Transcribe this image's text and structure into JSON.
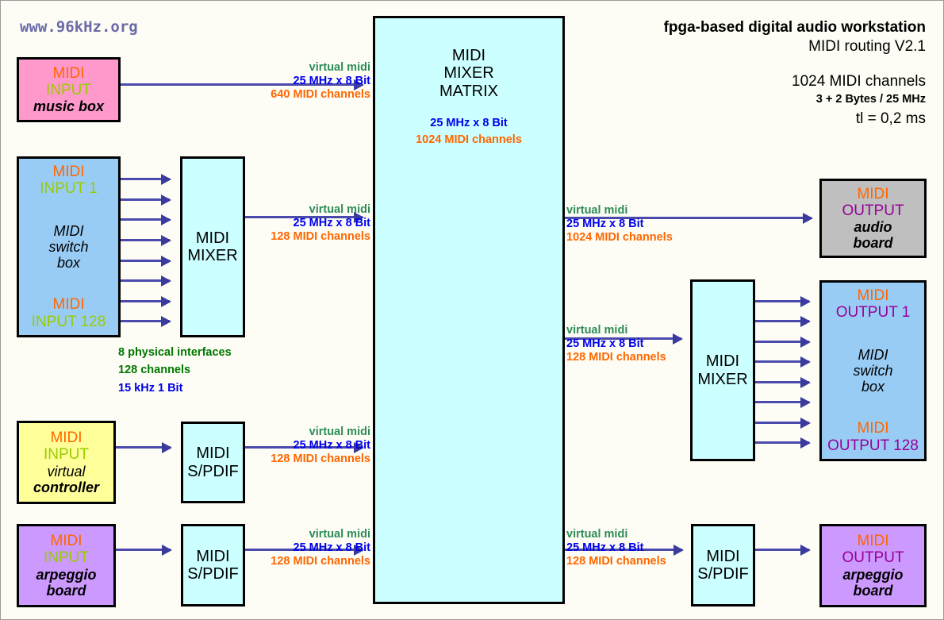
{
  "site_label": "www.96kHz.org",
  "header": {
    "title": "fpga-based digital audio workstation",
    "subtitle": "MIDI routing V2.1",
    "channels": "1024 MIDI channels",
    "bytes": "3 + 2 Bytes / 25 MHz",
    "latency": "tl = 0,2 ms"
  },
  "colors": {
    "pink": "#ff99cc",
    "blue": "#99ccf5",
    "yellow": "#ffff99",
    "purple": "#cc99ff",
    "grey": "#bfbfbf",
    "cyan": "#ccffff",
    "orange_text": "#ff6600",
    "green_text": "#99cc00",
    "purple_text": "#990099",
    "link_green": "#2e8b57",
    "link_blue": "#0000ee",
    "link_orange": "#ff6600",
    "arrow": "#4a4aad",
    "note_green": "#007700"
  },
  "boxes": {
    "input_music_box": {
      "midi": "MIDI",
      "io": "INPUT",
      "name1": "music box"
    },
    "input_switch_box": {
      "midi": "MIDI",
      "io": "INPUT 1",
      "name1": "MIDI",
      "name2": "switch",
      "name3": "box",
      "midi2": "MIDI",
      "io2": "INPUT 128"
    },
    "input_virtual": {
      "midi": "MIDI",
      "io": "INPUT",
      "name1": "virtual",
      "name2": "controller"
    },
    "input_arpeggio": {
      "midi": "MIDI",
      "io": "INPUT",
      "name1": "arpeggio",
      "name2": "board"
    },
    "mixer_left": {
      "line1": "MIDI",
      "line2": "MIXER"
    },
    "spdif_left_1": {
      "line1": "MIDI",
      "line2": "S/PDIF"
    },
    "spdif_left_2": {
      "line1": "MIDI",
      "line2": "S/PDIF"
    },
    "matrix": {
      "line1": "MIDI",
      "line2": "MIXER",
      "line3": "MATRIX",
      "rate": "25 MHz x 8 Bit",
      "channels": "1024 MIDI channels"
    },
    "mixer_right": {
      "line1": "MIDI",
      "line2": "MIXER"
    },
    "spdif_right": {
      "line1": "MIDI",
      "line2": "S/PDIF"
    },
    "output_audio": {
      "midi": "MIDI",
      "io": "OUTPUT",
      "name1": "audio",
      "name2": "board"
    },
    "output_switch_box": {
      "midi": "MIDI",
      "io": "OUTPUT 1",
      "name1": "MIDI",
      "name2": "switch",
      "name3": "box",
      "midi2": "MIDI",
      "io2": "OUTPUT 128"
    },
    "output_arpeggio": {
      "midi": "MIDI",
      "io": "OUTPUT",
      "name1": "arpeggio",
      "name2": "board"
    }
  },
  "links": {
    "music_to_matrix": {
      "l1": "virtual midi",
      "l2": "25 MHz x 8 Bit",
      "l3": "640 MIDI channels"
    },
    "mixer_to_matrix": {
      "l1": "virtual midi",
      "l2": "25 MHz x 8 Bit",
      "l3": "128 MIDI channels"
    },
    "spdif1_to_matrix": {
      "l1": "virtual midi",
      "l2": "25 MHz x 8 Bit",
      "l3": "128 MIDI channels"
    },
    "spdif2_to_matrix": {
      "l1": "virtual midi",
      "l2": "25 MHz x 8 Bit",
      "l3": "128 MIDI channels"
    },
    "matrix_to_audio": {
      "l1": "virtual midi",
      "l2": "25 MHz x 8 Bit",
      "l3": "1024 MIDI channels"
    },
    "matrix_to_mixer": {
      "l1": "virtual midi",
      "l2": "25 MHz x 8 Bit",
      "l3": "128 MIDI channels"
    },
    "matrix_to_spdif": {
      "l1": "virtual midi",
      "l2": "25 MHz x 8 Bit",
      "l3": "128 MIDI channels"
    }
  },
  "notes": {
    "physical": {
      "n1": "8 physical interfaces",
      "n2": "128 channels",
      "n3": "15 kHz 1 Bit"
    }
  }
}
